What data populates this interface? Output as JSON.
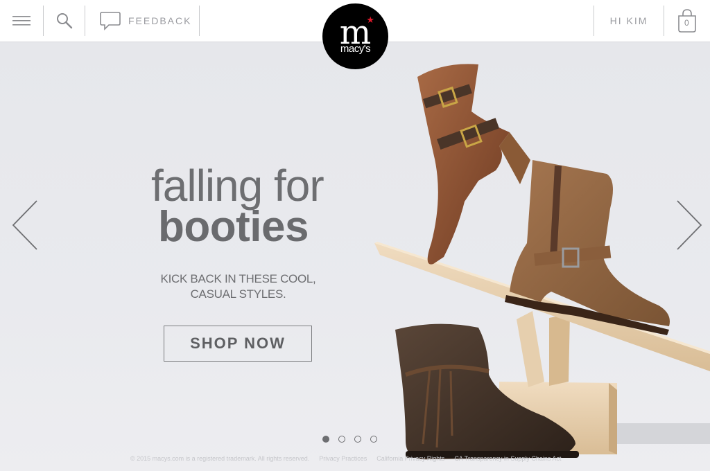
{
  "header": {
    "feedback_label": "FEEDBACK",
    "greeting": "HI KIM",
    "bag_count": "0"
  },
  "logo": {
    "brand": "macy's",
    "star_color": "#e21a2c"
  },
  "hero": {
    "headline_line1": "falling for",
    "headline_line2": "booties",
    "subline_1": "KICK BACK IN THESE COOL,",
    "subline_2": "CASUAL STYLES.",
    "cta": "SHOP NOW",
    "slide_count": 4,
    "active_slide": 1
  },
  "footer": {
    "copyright": "© 2015 macys.com is a registered trademark. All rights reserved.",
    "privacy": "Privacy Practices",
    "california": "California Privacy Rights",
    "ca_act": "CA Transparency in Supply Chains Act"
  }
}
